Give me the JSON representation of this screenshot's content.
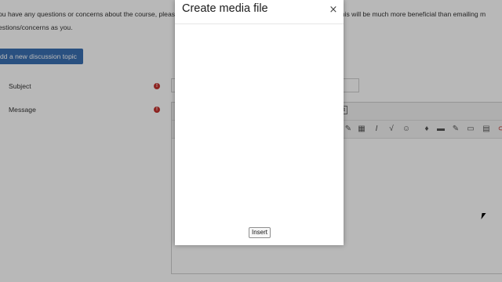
{
  "page": {
    "intro_line1": "ou have any questions or concerns about the course, please p",
    "intro_line1_right": "ssible. This will be much more beneficial than emailing m",
    "intro_line2": "estions/concerns as you.",
    "add_topic_label": "dd a new discussion topic"
  },
  "form": {
    "subject_label": "Subject",
    "message_label": "Message",
    "required_marker": "!"
  },
  "editor_icons": [
    "table-icon",
    "italic-icon",
    "sqrt-icon",
    "emoji-icon",
    "mic-icon",
    "video-icon",
    "pencil-icon",
    "folder-icon",
    "grid-icon",
    "copy-icon"
  ],
  "modal": {
    "title": "Create media file",
    "close": "×",
    "insert_label": "Insert"
  },
  "colors": {
    "accent": "#3a6fb2",
    "required": "#c4322f",
    "overlay": "rgba(0,0,0,0.28)"
  }
}
